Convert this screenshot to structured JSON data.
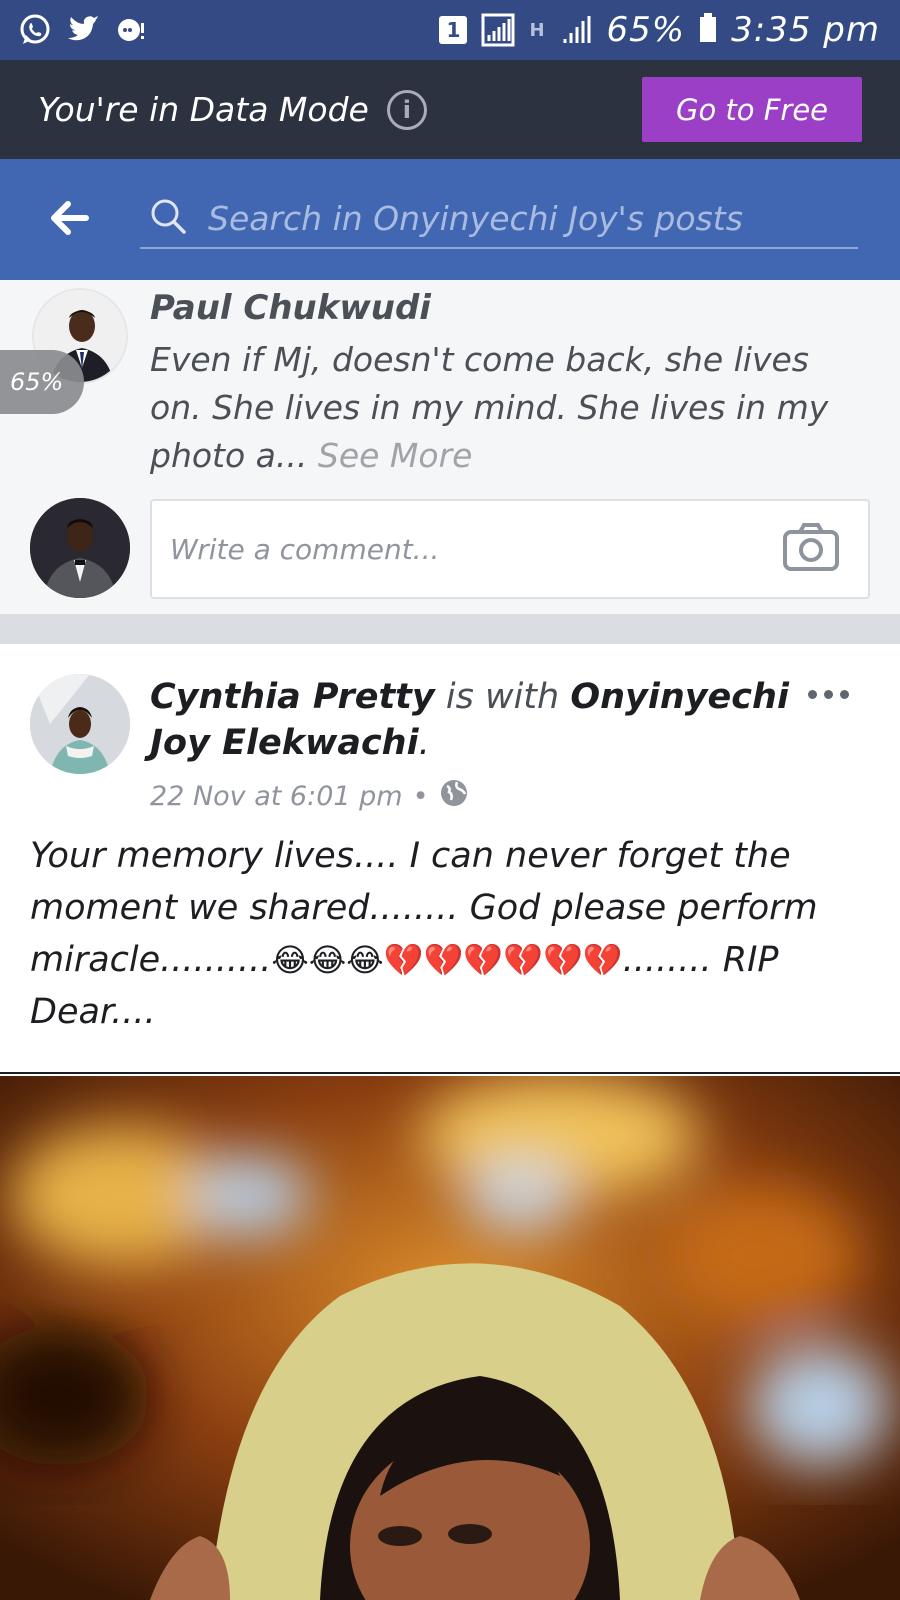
{
  "status_bar": {
    "sim_badge": "1",
    "network_label": "H",
    "battery_percent": "65%",
    "time": "3:35 pm"
  },
  "data_mode": {
    "text": "You're in Data Mode",
    "info_icon": "i",
    "button_label": "Go to Free",
    "button_color": "#9a3fc6"
  },
  "search": {
    "placeholder": "Search in Onyinyechi Joy's posts"
  },
  "comment": {
    "author": "Paul Chukwudi",
    "text": "Even if Mj, doesn't come back, she lives on. She lives in my mind. She lives in my photo a...",
    "see_more": "See More",
    "overlay_battery": "65%",
    "input_placeholder": "Write a comment..."
  },
  "post": {
    "author": "Cynthia Pretty",
    "with_text": "is with",
    "tagged": "Onyinyechi Joy Elekwachi",
    "end_punct": ".",
    "timestamp": "22 Nov at 6:01 pm",
    "separator": "•",
    "body_part1": "Your memory lives....  I can never forget the moment we shared........  God please perform miracle..........",
    "body_emojis": "😂😂😂💔💔💔💔💔💔",
    "body_part2": "........ RIP Dear...."
  },
  "colors": {
    "status_bar": "#344a84",
    "banner": "#2d3241",
    "search_bar": "#4267b2",
    "divider": "#dadde1"
  },
  "icons": [
    "whatsapp-icon",
    "twitter-icon",
    "chat-bubble-icon",
    "signal-icon",
    "battery-icon",
    "info-icon",
    "back-arrow-icon",
    "search-icon",
    "camera-icon",
    "more-dots-icon",
    "globe-icon"
  ]
}
